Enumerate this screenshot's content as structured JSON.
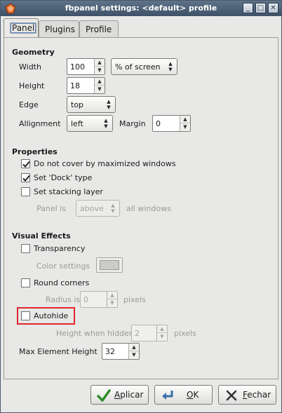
{
  "window": {
    "title": "fbpanel settings: <default> profile",
    "buttons": {
      "minimize": "_",
      "maximize": "□",
      "close": "✕"
    }
  },
  "tabs": [
    "Panel",
    "Plugins",
    "Profile"
  ],
  "geometry": {
    "title": "Geometry",
    "width_label": "Width",
    "width_value": "100",
    "width_unit": "% of screen",
    "height_label": "Height",
    "height_value": "18",
    "edge_label": "Edge",
    "edge_value": "top",
    "alignment_label": "Allignment",
    "alignment_value": "left",
    "margin_label": "Margin",
    "margin_value": "0"
  },
  "properties": {
    "title": "Properties",
    "no_cover_label": "Do not cover by maximized windows",
    "no_cover_checked": true,
    "dock_label": "Set 'Dock' type",
    "dock_checked": true,
    "stacking_label": "Set stacking layer",
    "stacking_checked": false,
    "panel_is_label": "Panel is",
    "panel_is_value": "above",
    "all_windows_label": "all windows"
  },
  "visual_effects": {
    "title": "Visual Effects",
    "transparency_label": "Transparency",
    "transparency_checked": false,
    "color_settings_label": "Color settings",
    "round_corners_label": "Round corners",
    "round_corners_checked": false,
    "radius_label": "Radius is",
    "radius_value": "0",
    "radius_unit": "pixels",
    "autohide_label": "Autohide",
    "autohide_checked": false,
    "hidden_height_label": "Height when hidden is",
    "hidden_height_value": "2",
    "hidden_height_unit": "pixels",
    "max_element_label": "Max Element Height",
    "max_element_value": "32"
  },
  "dialog_buttons": {
    "apply_prefix": "",
    "apply_mnemonic": "A",
    "apply_rest": "plicar",
    "ok_mnemonic": "O",
    "ok_rest": "K",
    "close_mnemonic": "F",
    "close_rest": "echar"
  },
  "colors": {
    "titlebar": "#4e6279",
    "highlight": "#e0262c",
    "check_green": "#2f8d2a"
  }
}
